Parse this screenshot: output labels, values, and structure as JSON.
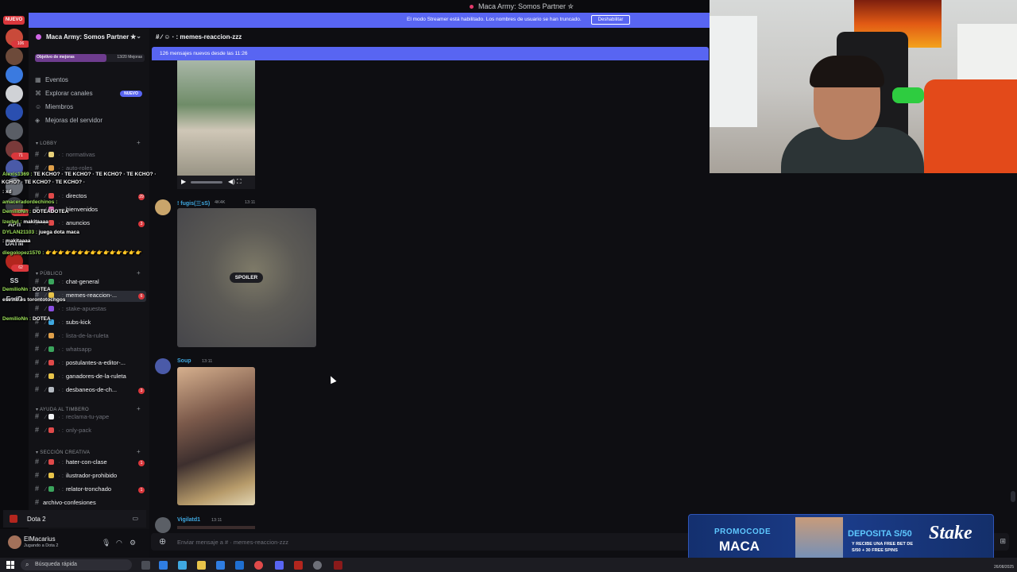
{
  "window": {
    "title": "Maca Army: Somos Partner ✮"
  },
  "streamer_banner": {
    "text": "El modo Streamer está habilitado. Los nombres de usuario se han truncado.",
    "button": "Deshabilitar"
  },
  "servers": {
    "nuevo": "NUEVO",
    "items": [
      {
        "label": "",
        "badge": "106"
      },
      {
        "label": "",
        "badge": ""
      },
      {
        "label": "",
        "badge": ""
      },
      {
        "label": "",
        "badge": ""
      },
      {
        "label": "",
        "badge": ""
      },
      {
        "label": "",
        "badge": ""
      },
      {
        "label": "",
        "badge": "71"
      },
      {
        "label": "",
        "badge": ""
      },
      {
        "label": "",
        "badge": ""
      },
      {
        "label": "",
        "badge": "324"
      },
      {
        "label": "APh",
        "badge": ""
      },
      {
        "label": "DAYM",
        "badge": ""
      },
      {
        "label": "",
        "badge": "62"
      },
      {
        "label": "SS",
        "badge": ""
      },
      {
        "label": "EsdD",
        "badge": ""
      }
    ]
  },
  "guild": {
    "name": "Maca Army: Somos Partner ✮",
    "boost_label": "Objetivo de mejoras",
    "boost_count": "13/20 Mejoras",
    "boost_fraction": 0.65,
    "nav": [
      {
        "label": "Eventos",
        "icon": "calendar-icon"
      },
      {
        "label": "Explorar canales",
        "icon": "compass-icon",
        "tag": "NUEVO"
      },
      {
        "label": "Miembros",
        "icon": "members-icon"
      },
      {
        "label": "Mejoras del servidor",
        "icon": "boost-icon"
      }
    ],
    "categories": [
      {
        "name": "LOBBY"
      },
      {
        "name": "PÚBLICO"
      },
      {
        "name": "AYUDA AL TIMBERO"
      },
      {
        "name": "SECCIÓN CREATIVA"
      }
    ],
    "channels": [
      {
        "name": "normativas",
        "color": "#e8d07a",
        "state": "dim",
        "count": ""
      },
      {
        "name": "auto-roles",
        "color": "#e0a04a",
        "state": "dim",
        "count": ""
      },
      {
        "name": "directos",
        "color": "#e04a4a",
        "state": "bright",
        "count": "29"
      },
      {
        "name": "bienvenidos",
        "color": "#d46bb0",
        "state": "bright",
        "count": ""
      },
      {
        "name": "anuncios",
        "color": "#e04a4a",
        "state": "bright",
        "count": "3"
      },
      {
        "name": "chat-general",
        "color": "#3ba55d",
        "state": "bright",
        "count": ""
      },
      {
        "name": "memes-reaccion-...",
        "color": "#e8c44a",
        "state": "sel",
        "count": "6"
      },
      {
        "name": "stake-apuestas",
        "color": "#8a4fe0",
        "state": "dim",
        "count": ""
      },
      {
        "name": "subs-kick",
        "color": "#3fa8e0",
        "state": "bright",
        "count": ""
      },
      {
        "name": "lista-de-la-ruleta",
        "color": "#e0a04a",
        "state": "dim",
        "count": ""
      },
      {
        "name": "whatsapp",
        "color": "#3ba55d",
        "state": "dim",
        "count": ""
      },
      {
        "name": "postulantes-a-editor-...",
        "color": "#e04a4a",
        "state": "bright",
        "count": ""
      },
      {
        "name": "ganadores-de-la-ruleta",
        "color": "#e8c44a",
        "state": "bright",
        "count": ""
      },
      {
        "name": "desbaneos-de-ch...",
        "color": "#b5bac1",
        "state": "bright",
        "count": "3"
      },
      {
        "name": "reclama-tu-yape",
        "color": "#f2f3f5",
        "state": "dim",
        "count": ""
      },
      {
        "name": "only-pack",
        "color": "#e04a4a",
        "state": "dim",
        "count": ""
      },
      {
        "name": "hater-con-clase",
        "color": "#e04a4a",
        "state": "bright",
        "count": "1"
      },
      {
        "name": "ilustrador-prohibido",
        "color": "#e8c44a",
        "state": "bright",
        "count": ""
      },
      {
        "name": "relator-tronchado",
        "color": "#3ba55d",
        "state": "bright",
        "count": "1"
      },
      {
        "name": "archivo-confesiones",
        "color": "",
        "state": "bright",
        "count": ""
      }
    ]
  },
  "voice": {
    "label": "Dota 2"
  },
  "user": {
    "name": "ElMacarius",
    "status": "Jugando a Dota 2"
  },
  "chat": {
    "channel": "memes-reaccion-zzz",
    "new_messages": "126 mensajes nuevos desde las 11:26",
    "spoiler": "SPOILER",
    "messages": [
      {
        "author": "! fugis(三sS)",
        "badge": "4K4K",
        "time": "13:11",
        "color": "#3fa8e0"
      },
      {
        "author": "Soup",
        "badge": "",
        "time": "13:11",
        "color": "#3fa8e0"
      },
      {
        "author": "Vigilatd1",
        "badge": "",
        "time": "13:11",
        "color": "#3fa8e0"
      }
    ],
    "placeholder": "Enviar mensaje a #  ·  memes-reaccion-zzz"
  },
  "stream_chat": [
    {
      "user": "Alexis1369 :",
      "msg": "TE KCHO? · TE KCHO? · TE KCHO? · TE KCHO? ·"
    },
    {
      "user": "",
      "msg": "KCHO? · TE KCHO? · TE KCHO? ·"
    },
    {
      "user": "",
      "msg": ": xd"
    },
    {
      "user": "amaceradordechinos :",
      "msg": ""
    },
    {
      "user": "DemilioNn :",
      "msg": "DOTEADOTEA"
    },
    {
      "user": "Izerbyl :",
      "msg": "makitaaaa"
    },
    {
      "user": "DYLAN21103 :",
      "msg": "juega dota maca"
    },
    {
      "user": "",
      "msg": ": makitaaaa"
    },
    {
      "user": "diegolopez1570 :",
      "msg": "👉👉👉👉👉👉👉👉👉👉👉👉👉👉👉"
    },
    {
      "user": "DemilioNn :",
      "msg": "DOTEA"
    },
    {
      "user": "",
      "msg": "ese no es torontotochgos"
    },
    {
      "user": "DemilioNn :",
      "msg": "DOTEA"
    }
  ],
  "ad": {
    "line1": "PROMOCODE",
    "line2": "MACA",
    "dep": "DEPOSITA S/50",
    "sub1": "Y RECIBE UNA FREE BET DE",
    "sub2": "S/50 + 30 FREE SPINS",
    "brand": "Stake"
  },
  "taskbar": {
    "search": "Búsqueda rápida",
    "date": "26/08/2025"
  },
  "colors": {
    "accent": "#5865f2",
    "danger": "#da373c",
    "bg": "#0e0e12"
  }
}
